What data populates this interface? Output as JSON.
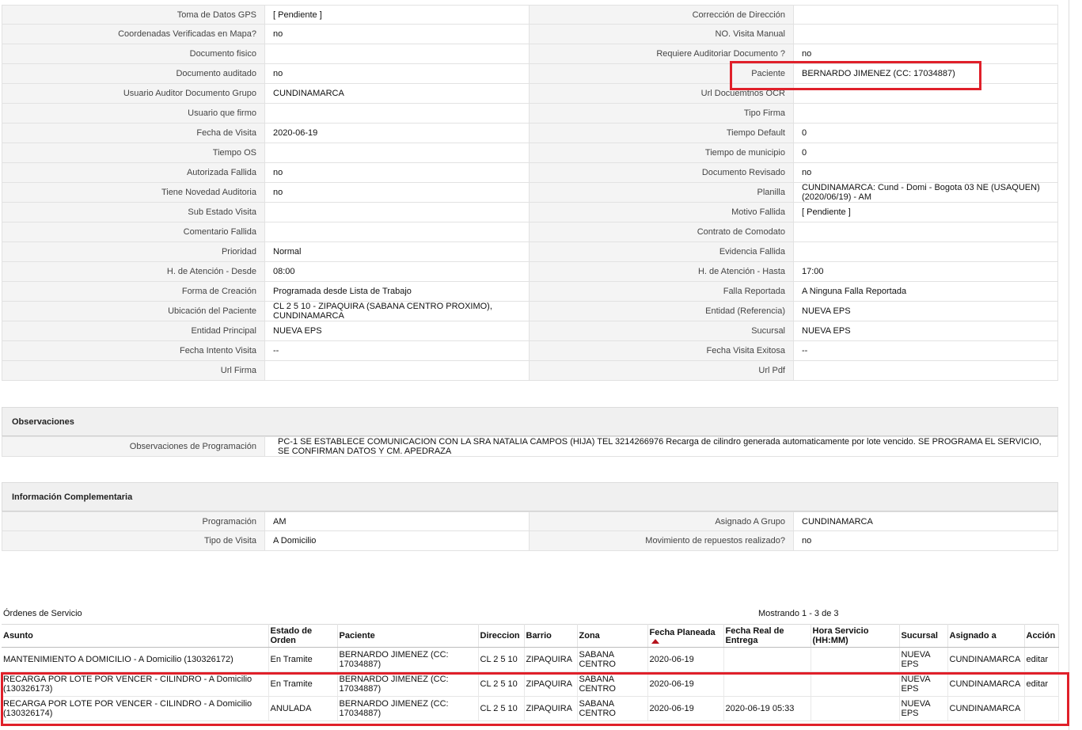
{
  "details": {
    "rows": [
      {
        "l1": "Toma de Datos GPS",
        "v1": "[ Pendiente ]",
        "l2": "Corrección de Dirección",
        "v2": ""
      },
      {
        "l1": "Coordenadas Verificadas en Mapa?",
        "v1": "no",
        "l2": "NO. Visita Manual",
        "v2": ""
      },
      {
        "l1": "Documento fisico",
        "v1": "",
        "l2": "Requiere Auditoriar Documento ?",
        "v2": "no"
      },
      {
        "l1": "Documento auditado",
        "v1": "no",
        "l2": "Paciente",
        "v2": "BERNARDO JIMENEZ (CC: 17034887)"
      },
      {
        "l1": "Usuario Auditor Documento Grupo",
        "v1": "CUNDINAMARCA",
        "l2": "Url Docuemtnos OCR",
        "v2": ""
      },
      {
        "l1": "Usuario que firmo",
        "v1": "",
        "l2": "Tipo Firma",
        "v2": ""
      },
      {
        "l1": "Fecha de Visita",
        "v1": "2020-06-19",
        "l2": "Tiempo Default",
        "v2": "0"
      },
      {
        "l1": "Tiempo OS",
        "v1": "",
        "l2": "Tiempo de municipio",
        "v2": "0"
      },
      {
        "l1": "Autorizada Fallida",
        "v1": "no",
        "l2": "Documento Revisado",
        "v2": "no"
      },
      {
        "l1": "Tiene Novedad Auditoria",
        "v1": "no",
        "l2": "Planilla",
        "v2": "CUNDINAMARCA: Cund - Domi - Bogota 03 NE (USAQUEN) (2020/06/19) - AM"
      },
      {
        "l1": "Sub Estado Visita",
        "v1": "",
        "l2": "Motivo Fallida",
        "v2": "[ Pendiente ]"
      },
      {
        "l1": "Comentario Fallida",
        "v1": "",
        "l2": "Contrato de Comodato",
        "v2": ""
      },
      {
        "l1": "Prioridad",
        "v1": "Normal",
        "l2": "Evidencia Fallida",
        "v2": ""
      },
      {
        "l1": "H. de Atención - Desde",
        "v1": "08:00",
        "l2": "H. de Atención - Hasta",
        "v2": "17:00"
      },
      {
        "l1": "Forma de Creación",
        "v1": "Programada desde Lista de Trabajo",
        "l2": "Falla Reportada",
        "v2": "A Ninguna Falla Reportada"
      },
      {
        "l1": "Ubicación del Paciente",
        "v1": "CL 2 5 10 - ZIPAQUIRA (SABANA CENTRO PROXIMO), CUNDINAMARCA",
        "l2": "Entidad (Referencia)",
        "v2": "NUEVA EPS"
      },
      {
        "l1": "Entidad Principal",
        "v1": "NUEVA EPS",
        "l2": "Sucursal",
        "v2": "NUEVA EPS"
      },
      {
        "l1": "Fecha Intento Visita",
        "v1": "--",
        "l2": "Fecha Visita Exitosa",
        "v2": "--"
      },
      {
        "l1": "Url Firma",
        "v1": "",
        "l2": "Url Pdf",
        "v2": ""
      }
    ]
  },
  "observaciones": {
    "title": "Observaciones",
    "label": "Observaciones de Programación",
    "value": "PC-1 SE ESTABLECE COMUNICACION CON LA SRA NATALIA CAMPOS (HIJA) TEL 3214266976 Recarga de cilindro generada automaticamente por lote vencido. SE PROGRAMA EL SERVICIO, SE CONFIRMAN DATOS Y CM. APEDRAZA"
  },
  "complementaria": {
    "title": "Información Complementaria",
    "rows": [
      {
        "l1": "Programación",
        "v1": "AM",
        "l2": "Asignado A Grupo",
        "v2": "CUNDINAMARCA"
      },
      {
        "l1": "Tipo de Visita",
        "v1": "A Domicilio",
        "l2": "Movimiento de repuestos realizado?",
        "v2": "no"
      }
    ]
  },
  "orders": {
    "title": "Órdenes de Servicio",
    "count": "Mostrando 1 - 3 de 3",
    "headers": [
      "Asunto",
      "Estado de Orden",
      "Paciente",
      "Direccion",
      "Barrio",
      "Zona",
      "Fecha Planeada",
      "Fecha Real de Entrega",
      "Hora Servicio (HH:MM)",
      "Sucursal",
      "Asignado a",
      "Acción"
    ],
    "rows": [
      [
        "MANTENIMIENTO A DOMICILIO - A Domicilio (130326172)",
        "En Tramite",
        "BERNARDO JIMENEZ (CC: 17034887)",
        "CL 2 5 10",
        "ZIPAQUIRA",
        "SABANA CENTRO",
        "2020-06-19",
        "",
        "",
        "NUEVA EPS",
        "CUNDINAMARCA",
        "editar"
      ],
      [
        "RECARGA POR LOTE POR VENCER - CILINDRO - A Domicilio (130326173)",
        "En Tramite",
        "BERNARDO JIMENEZ (CC: 17034887)",
        "CL 2 5 10",
        "ZIPAQUIRA",
        "SABANA CENTRO",
        "2020-06-19",
        "",
        "",
        "NUEVA EPS",
        "CUNDINAMARCA",
        "editar"
      ],
      [
        "RECARGA POR LOTE POR VENCER - CILINDRO - A Domicilio (130326174)",
        "ANULADA",
        "BERNARDO JIMENEZ (CC: 17034887)",
        "CL 2 5 10",
        "ZIPAQUIRA",
        "SABANA CENTRO",
        "2020-06-19",
        "2020-06-19 05:33",
        "",
        "NUEVA EPS",
        "CUNDINAMARCA",
        ""
      ]
    ]
  },
  "colors": {
    "highlight": "#e0202a",
    "label_bg": "#f4f4f4",
    "header_bg": "#f0f0f0"
  }
}
